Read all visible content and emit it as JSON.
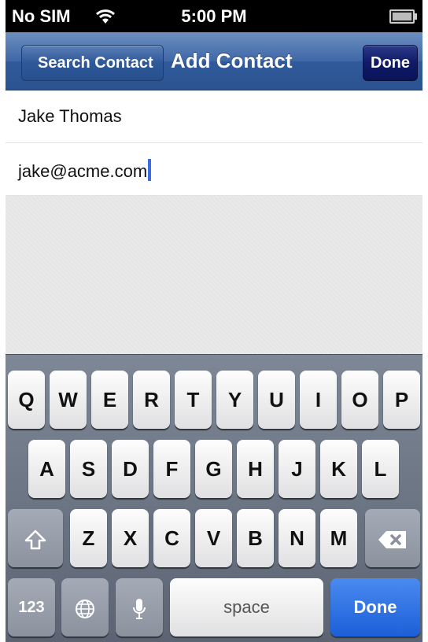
{
  "status_bar": {
    "carrier": "No SIM",
    "time": "5:00 PM"
  },
  "navbar": {
    "back_label": "Search Contact",
    "title": "Add Contact",
    "done_label": "Done"
  },
  "form": {
    "name_value": "Jake Thomas",
    "email_value": "jake@acme.com"
  },
  "keyboard": {
    "row1": [
      "Q",
      "W",
      "E",
      "R",
      "T",
      "Y",
      "U",
      "I",
      "O",
      "P"
    ],
    "row2": [
      "A",
      "S",
      "D",
      "F",
      "G",
      "H",
      "J",
      "K",
      "L"
    ],
    "row3": [
      "Z",
      "X",
      "C",
      "V",
      "B",
      "N",
      "M"
    ],
    "numbers_label": "123",
    "space_label": "space",
    "done_label": "Done",
    "icons": {
      "shift": "shift-icon",
      "delete": "backspace-icon",
      "globe": "globe-icon",
      "mic": "microphone-icon"
    }
  },
  "colors": {
    "nav_blue": "#3f68a7",
    "done_blue": "#1c5fd8",
    "cursor": "#3b6fe0"
  }
}
